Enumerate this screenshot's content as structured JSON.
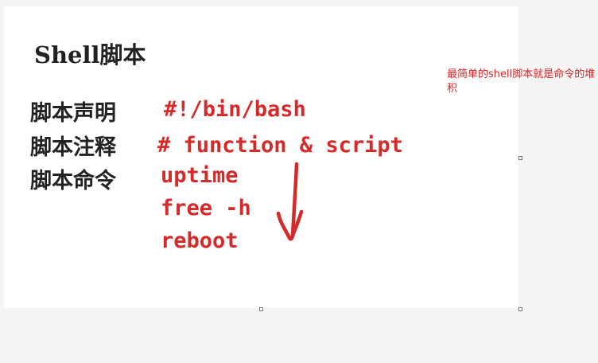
{
  "slide": {
    "title": "Shell脚本",
    "rows": [
      {
        "label": "脚本声明",
        "code": "#!/bin/bash"
      },
      {
        "label": "脚本注释",
        "code": "# function & script"
      },
      {
        "label": "脚本命令",
        "code": "uptime"
      }
    ],
    "extra_commands": [
      "free -h",
      "reboot"
    ]
  },
  "annotation": {
    "text": "最简单的shell脚本就是命令的堆积",
    "color": "#e02020"
  },
  "colors": {
    "code": "#d42a2a",
    "label": "#222222",
    "slide_background": "#ffffff",
    "page_background": "#f4f4f4"
  },
  "icons": [
    "hand-drawn-down-arrow-icon",
    "resize-handle-icon"
  ]
}
